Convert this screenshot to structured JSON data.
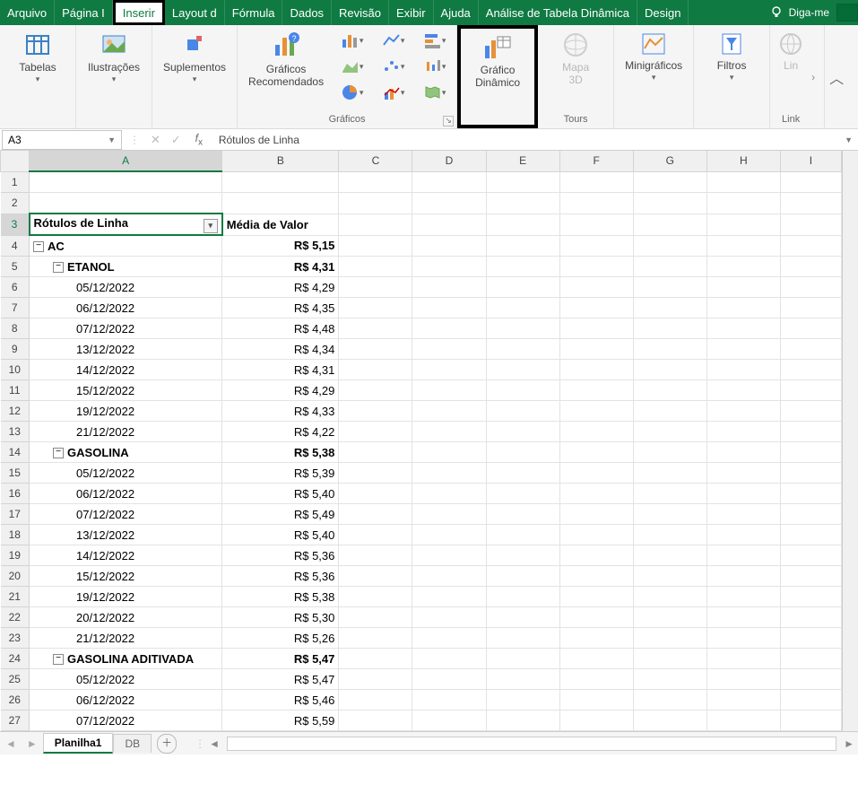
{
  "menu": {
    "items": [
      "Arquivo",
      "Página I",
      "Inserir",
      "Layout d",
      "Fórmula",
      "Dados",
      "Revisão",
      "Exibir",
      "Ajuda",
      "Análise de Tabela Dinâmica",
      "Design"
    ],
    "selected_index": 2,
    "tell_me": "Diga-me"
  },
  "ribbon": {
    "tables": {
      "label": "Tabelas"
    },
    "illustrations": {
      "label": "Ilustrações"
    },
    "addins": {
      "label": "Suplementos"
    },
    "recommended_charts": {
      "label": "Gráficos\nRecomendados"
    },
    "charts_group_label": "Gráficos",
    "dynchart": {
      "label": "Gráfico\nDinâmico"
    },
    "map3d": {
      "label": "Mapa\n3D"
    },
    "tours_group_label": "Tours",
    "sparklines": {
      "label": "Minigráficos"
    },
    "filters": {
      "label": "Filtros"
    },
    "link": {
      "label": "Lin"
    },
    "link_group_label": "Link"
  },
  "namebox": {
    "value": "A3"
  },
  "formula_bar": {
    "value": "Rótulos de Linha"
  },
  "columns": [
    "",
    "A",
    "B",
    "C",
    "D",
    "E",
    "F",
    "G",
    "H",
    "I"
  ],
  "selected_col_index": 1,
  "selected_row": 3,
  "pivot": {
    "header_rowlabels": "Rótulos de Linha",
    "header_value": "Média de Valor",
    "rows": [
      {
        "r": 4,
        "level": 0,
        "collapse": true,
        "bold": true,
        "label": "AC",
        "value": "R$ 5,15"
      },
      {
        "r": 5,
        "level": 1,
        "collapse": true,
        "bold": true,
        "label": "ETANOL",
        "value": "R$ 4,31"
      },
      {
        "r": 6,
        "level": 2,
        "label": "05/12/2022",
        "value": "R$ 4,29"
      },
      {
        "r": 7,
        "level": 2,
        "label": "06/12/2022",
        "value": "R$ 4,35"
      },
      {
        "r": 8,
        "level": 2,
        "label": "07/12/2022",
        "value": "R$ 4,48"
      },
      {
        "r": 9,
        "level": 2,
        "label": "13/12/2022",
        "value": "R$ 4,34"
      },
      {
        "r": 10,
        "level": 2,
        "label": "14/12/2022",
        "value": "R$ 4,31"
      },
      {
        "r": 11,
        "level": 2,
        "label": "15/12/2022",
        "value": "R$ 4,29"
      },
      {
        "r": 12,
        "level": 2,
        "label": "19/12/2022",
        "value": "R$ 4,33"
      },
      {
        "r": 13,
        "level": 2,
        "label": "21/12/2022",
        "value": "R$ 4,22"
      },
      {
        "r": 14,
        "level": 1,
        "collapse": true,
        "bold": true,
        "label": "GASOLINA",
        "value": "R$ 5,38"
      },
      {
        "r": 15,
        "level": 2,
        "label": "05/12/2022",
        "value": "R$ 5,39"
      },
      {
        "r": 16,
        "level": 2,
        "label": "06/12/2022",
        "value": "R$ 5,40"
      },
      {
        "r": 17,
        "level": 2,
        "label": "07/12/2022",
        "value": "R$ 5,49"
      },
      {
        "r": 18,
        "level": 2,
        "label": "13/12/2022",
        "value": "R$ 5,40"
      },
      {
        "r": 19,
        "level": 2,
        "label": "14/12/2022",
        "value": "R$ 5,36"
      },
      {
        "r": 20,
        "level": 2,
        "label": "15/12/2022",
        "value": "R$ 5,36"
      },
      {
        "r": 21,
        "level": 2,
        "label": "19/12/2022",
        "value": "R$ 5,38"
      },
      {
        "r": 22,
        "level": 2,
        "label": "20/12/2022",
        "value": "R$ 5,30"
      },
      {
        "r": 23,
        "level": 2,
        "label": "21/12/2022",
        "value": "R$ 5,26"
      },
      {
        "r": 24,
        "level": 1,
        "collapse": true,
        "bold": true,
        "label": "GASOLINA ADITIVADA",
        "value": "R$ 5,47"
      },
      {
        "r": 25,
        "level": 2,
        "label": "05/12/2022",
        "value": "R$ 5,47"
      },
      {
        "r": 26,
        "level": 2,
        "label": "06/12/2022",
        "value": "R$ 5,46"
      },
      {
        "r": 27,
        "level": 2,
        "label": "07/12/2022",
        "value": "R$ 5,59"
      }
    ]
  },
  "tabs": {
    "active": "Planilha1",
    "others": [
      "DB"
    ]
  }
}
